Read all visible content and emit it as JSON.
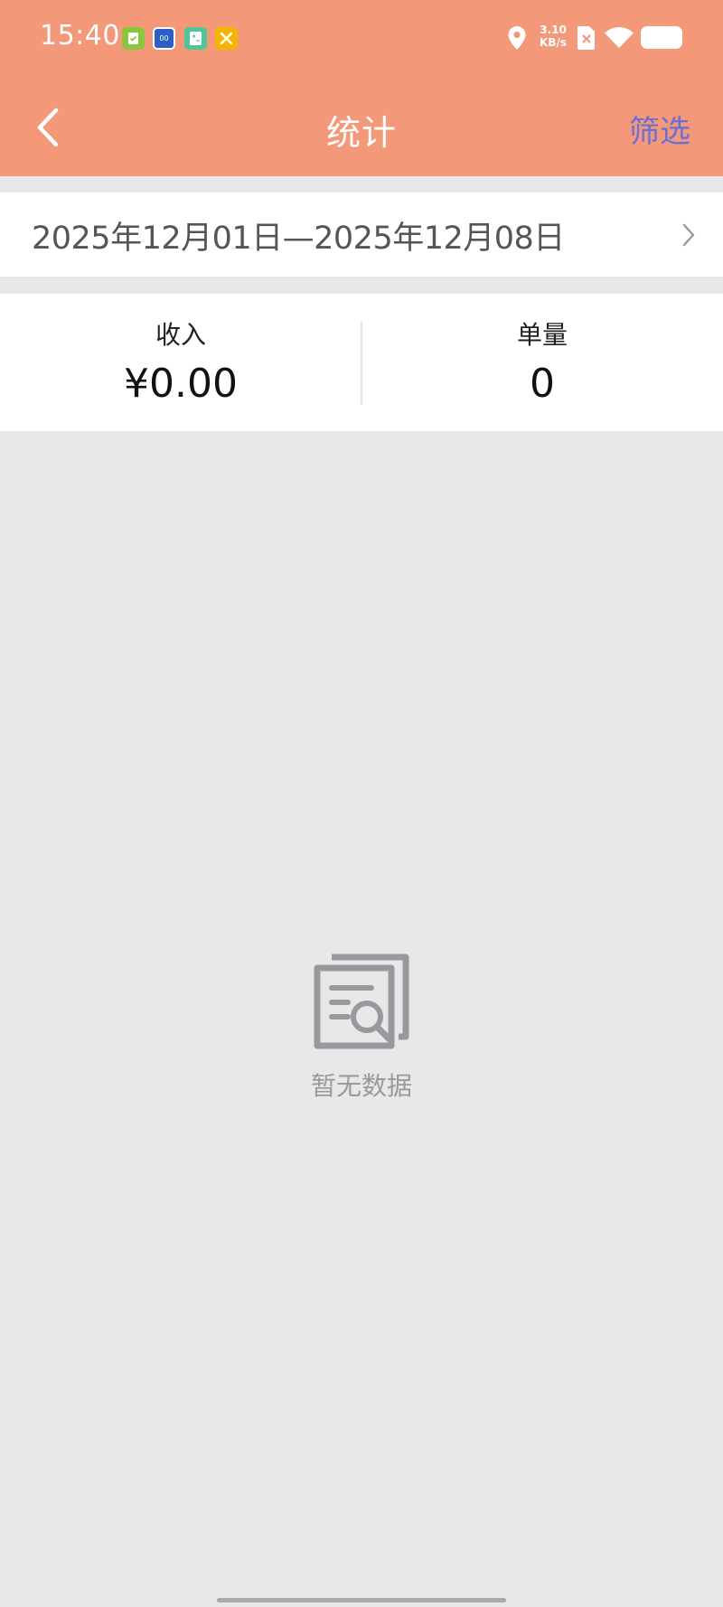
{
  "status_bar": {
    "time": "15:40",
    "net_speed_value": "3.10",
    "net_speed_unit": "KB/s",
    "icons": [
      "clipboard-app-icon",
      "calendar-app-icon",
      "calculator-app-icon",
      "tools-app-icon",
      "location-icon",
      "no-sim-icon",
      "wifi-icon",
      "battery-icon"
    ]
  },
  "nav": {
    "title": "统计",
    "filter_label": "筛选",
    "back_icon": "chevron-left-icon"
  },
  "date_range": {
    "text": "2025年12月01日—2025年12月08日"
  },
  "stats": {
    "income_label": "收入",
    "income_value": "¥0.00",
    "orders_label": "单量",
    "orders_value": "0"
  },
  "empty_state": {
    "text": "暂无数据",
    "icon": "document-search-icon"
  },
  "colors": {
    "header": "#f39879",
    "filter": "#6a6fd6",
    "background": "#e8e8e9"
  }
}
